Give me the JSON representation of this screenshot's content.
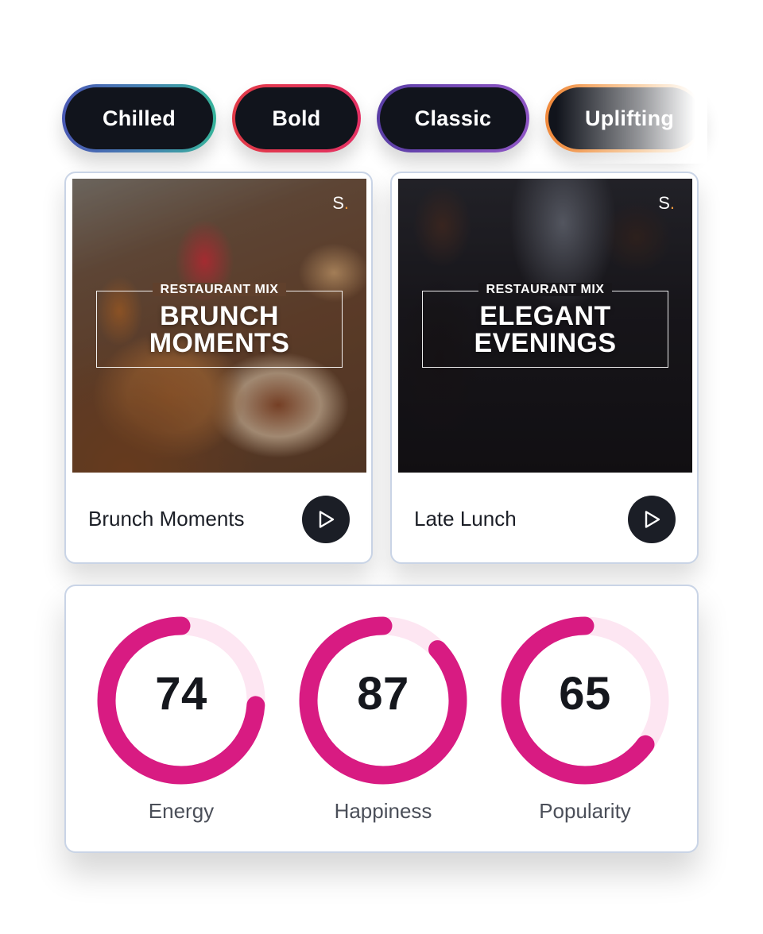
{
  "moods": [
    {
      "label": "Chilled"
    },
    {
      "label": "Bold"
    },
    {
      "label": "Classic"
    },
    {
      "label": "Uplifting"
    }
  ],
  "playlists": [
    {
      "cover_logo": "S",
      "cover_kicker": "RESTAURANT MIX",
      "cover_title_line1": "BRUNCH",
      "cover_title_line2": "MOMENTS",
      "name": "Brunch Moments",
      "play_icon": "play-icon"
    },
    {
      "cover_logo": "S",
      "cover_kicker": "RESTAURANT MIX",
      "cover_title_line1": "ELEGANT",
      "cover_title_line2": "EVENINGS",
      "name": "Late Lunch",
      "play_icon": "play-icon"
    }
  ],
  "stats": [
    {
      "value": 74,
      "label": "Energy"
    },
    {
      "value": 87,
      "label": "Happiness"
    },
    {
      "value": 65,
      "label": "Popularity"
    }
  ],
  "colors": {
    "gauge_fill": "#d81b82",
    "gauge_track": "#fde6f2",
    "pill_fill": "#11141c",
    "logo_dot": "#f09a3e"
  }
}
